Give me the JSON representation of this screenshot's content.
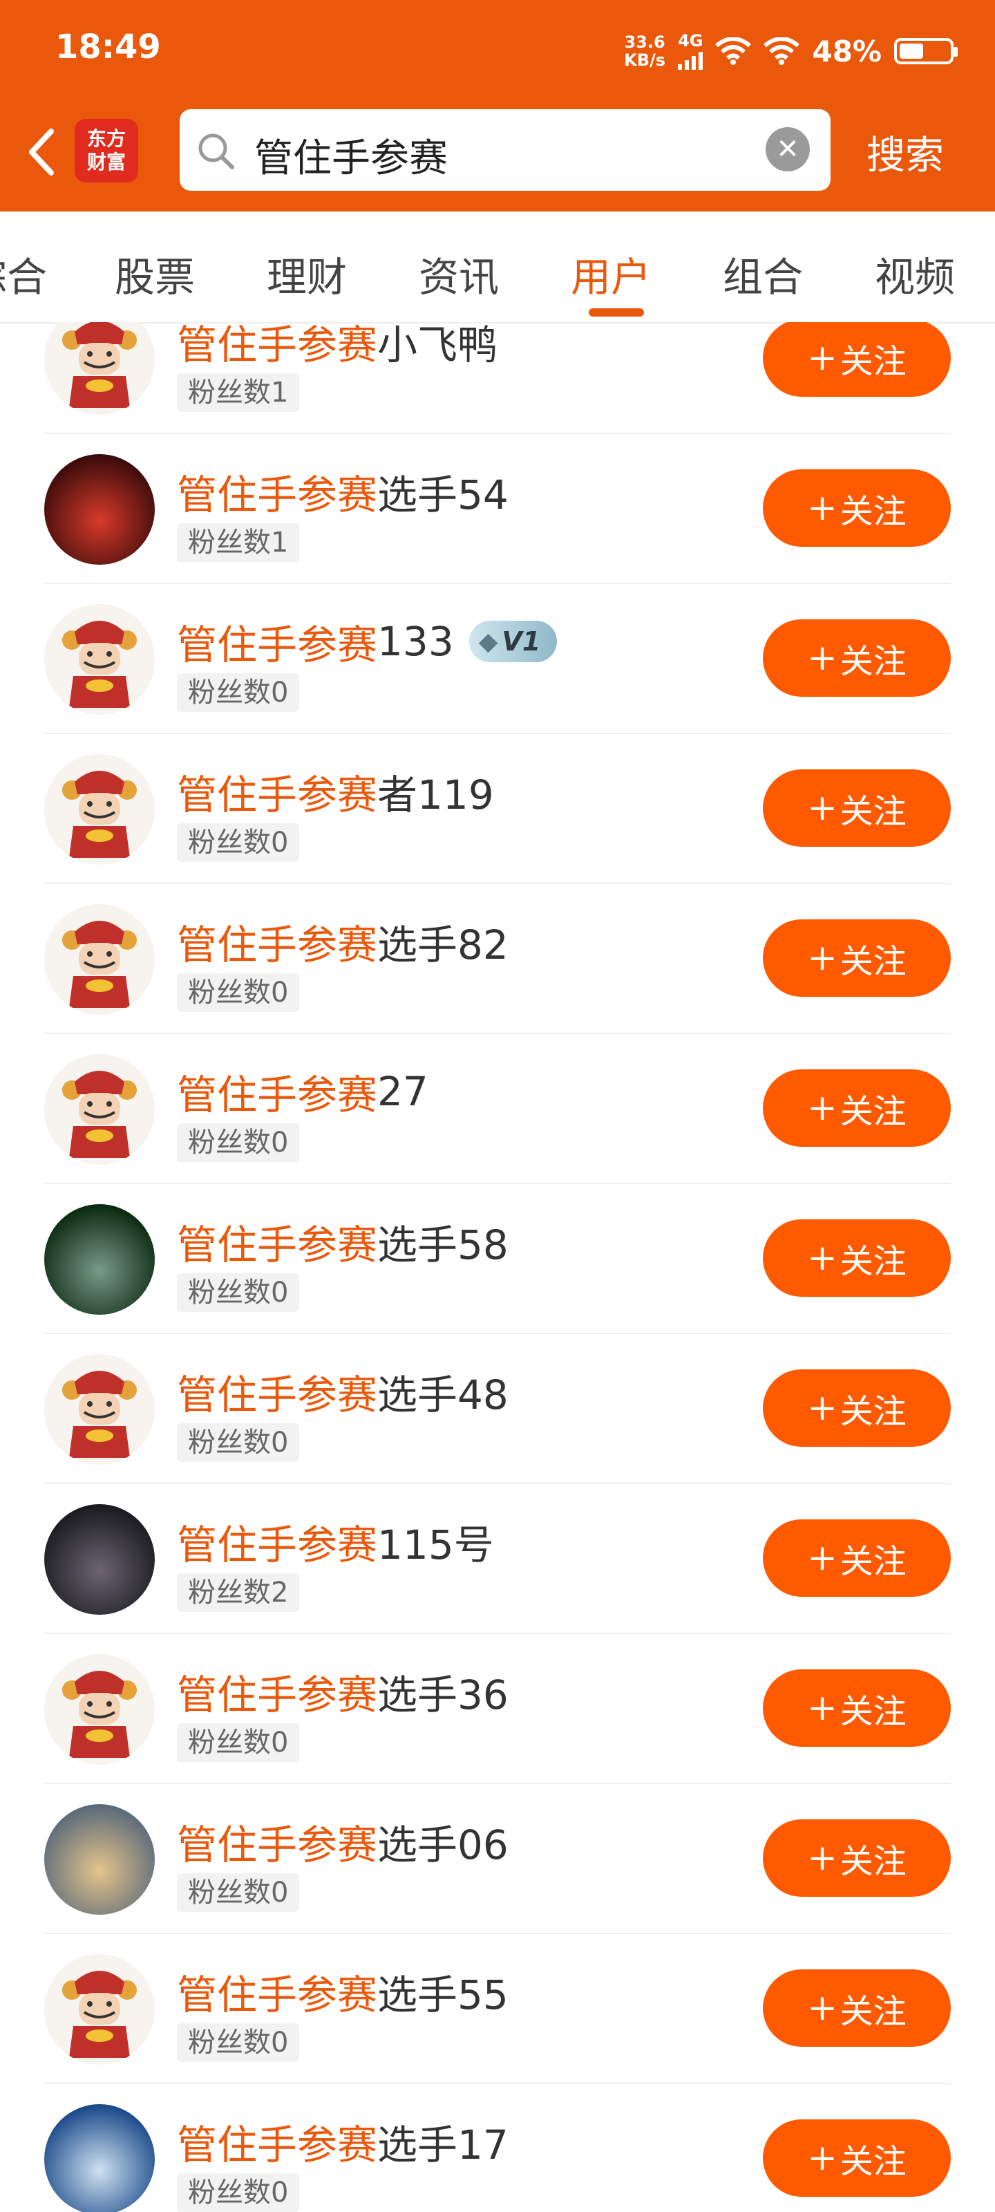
{
  "status_bar": {
    "time": "18:49",
    "net_speed_value": "33.6",
    "net_speed_unit": "KB/s",
    "network": "4G",
    "battery_percent": "48%",
    "battery_level": 0.48
  },
  "header": {
    "logo_line1": "东方",
    "logo_line2": "财富",
    "search_value": "管住手参赛",
    "search_button": "搜索",
    "accent_color": "#ea580c"
  },
  "tabs": [
    {
      "label": "综合",
      "active": false
    },
    {
      "label": "股票",
      "active": false
    },
    {
      "label": "理财",
      "active": false
    },
    {
      "label": "资讯",
      "active": false
    },
    {
      "label": "用户",
      "active": true
    },
    {
      "label": "组合",
      "active": false
    },
    {
      "label": "视频",
      "active": false
    }
  ],
  "results": [
    {
      "highlight": "管住手参赛",
      "suffix": "小飞鸭",
      "fans": "粉丝数1",
      "follow": "关注",
      "avatar": "mascot-avatar",
      "badge": null
    },
    {
      "highlight": "管住手参赛",
      "suffix": "选手54",
      "fans": "粉丝数1",
      "follow": "关注",
      "avatar": "photo-avatar",
      "badge": null
    },
    {
      "highlight": "管住手参赛",
      "suffix": "133",
      "fans": "粉丝数0",
      "follow": "关注",
      "avatar": "mascot-avatar",
      "badge": "V1"
    },
    {
      "highlight": "管住手参赛",
      "suffix": "者119",
      "fans": "粉丝数0",
      "follow": "关注",
      "avatar": "mascot-avatar",
      "badge": null
    },
    {
      "highlight": "管住手参赛",
      "suffix": "选手82",
      "fans": "粉丝数0",
      "follow": "关注",
      "avatar": "mascot-avatar",
      "badge": null
    },
    {
      "highlight": "管住手参赛",
      "suffix": "27",
      "fans": "粉丝数0",
      "follow": "关注",
      "avatar": "mascot-avatar",
      "badge": null
    },
    {
      "highlight": "管住手参赛",
      "suffix": "选手58",
      "fans": "粉丝数0",
      "follow": "关注",
      "avatar": "photo-avatar",
      "badge": null
    },
    {
      "highlight": "管住手参赛",
      "suffix": "选手48",
      "fans": "粉丝数0",
      "follow": "关注",
      "avatar": "mascot-avatar",
      "badge": null
    },
    {
      "highlight": "管住手参赛",
      "suffix": "115号",
      "fans": "粉丝数2",
      "follow": "关注",
      "avatar": "photo-avatar",
      "badge": null
    },
    {
      "highlight": "管住手参赛",
      "suffix": "选手36",
      "fans": "粉丝数0",
      "follow": "关注",
      "avatar": "mascot-avatar",
      "badge": null
    },
    {
      "highlight": "管住手参赛",
      "suffix": "选手06",
      "fans": "粉丝数0",
      "follow": "关注",
      "avatar": "photo-avatar",
      "badge": null
    },
    {
      "highlight": "管住手参赛",
      "suffix": "选手55",
      "fans": "粉丝数0",
      "follow": "关注",
      "avatar": "mascot-avatar",
      "badge": null
    },
    {
      "highlight": "管住手参赛",
      "suffix": "选手17",
      "fans": "粉丝数0",
      "follow": "关注",
      "avatar": "photo-avatar",
      "badge": null
    }
  ]
}
